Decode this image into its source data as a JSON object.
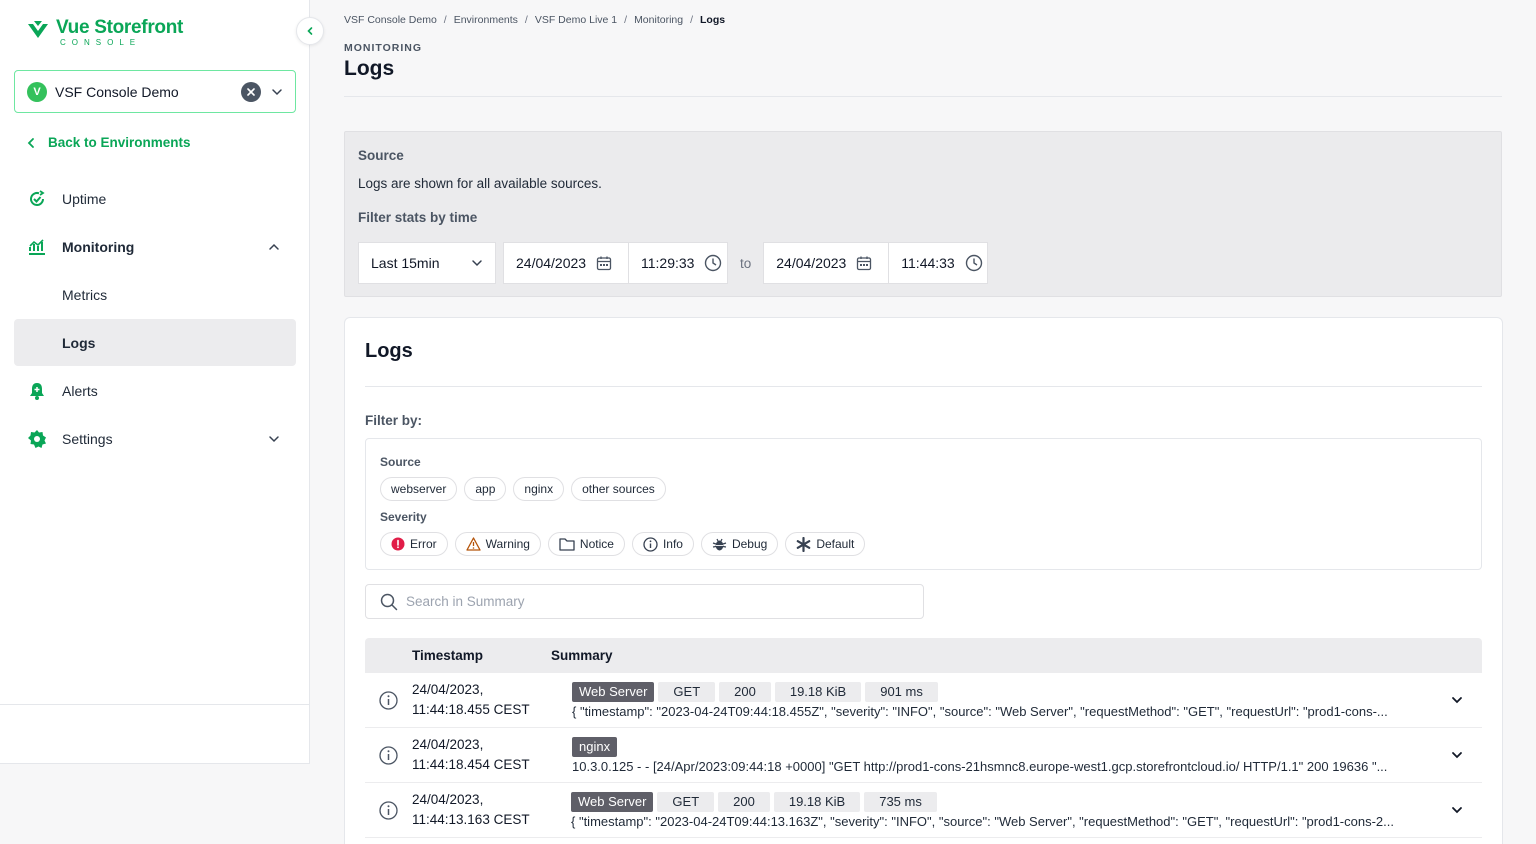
{
  "sidebar": {
    "logo_title": "Vue Storefront",
    "logo_subtitle": "CONSOLE",
    "organization": {
      "initial": "V",
      "name": "VSF Console Demo"
    },
    "back_label": "Back to Environments",
    "items": [
      {
        "label": "Uptime"
      },
      {
        "label": "Monitoring"
      },
      {
        "label": "Metrics"
      },
      {
        "label": "Logs"
      },
      {
        "label": "Alerts"
      },
      {
        "label": "Settings"
      }
    ]
  },
  "breadcrumb": [
    "VSF Console Demo",
    "Environments",
    "VSF Demo Live 1",
    "Monitoring",
    "Logs"
  ],
  "page": {
    "kicker": "MONITORING",
    "title": "Logs"
  },
  "source_panel": {
    "heading": "Source",
    "text": "Logs are shown for all available sources.",
    "filter_heading": "Filter stats by time",
    "range": "Last 15min",
    "from_date": "24/04/2023",
    "from_time": "11:29:33",
    "to_label": "to",
    "to_date": "24/04/2023",
    "to_time": "11:44:33"
  },
  "logs": {
    "title": "Logs",
    "filter_by": "Filter by:",
    "source_label": "Source",
    "sources": [
      "webserver",
      "app",
      "nginx",
      "other sources"
    ],
    "severity_label": "Severity",
    "severities": [
      "Error",
      "Warning",
      "Notice",
      "Info",
      "Debug",
      "Default"
    ],
    "search_placeholder": "Search in Summary",
    "columns": {
      "timestamp": "Timestamp",
      "summary": "Summary"
    },
    "rows": [
      {
        "date": "24/04/2023,",
        "time": "11:44:18.455 CEST",
        "tags": [
          "Web Server",
          "GET",
          "200",
          "19.18 KiB",
          "901 ms"
        ],
        "summary": "{ \"timestamp\": \"2023-04-24T09:44:18.455Z\", \"severity\": \"INFO\", \"source\": \"Web Server\", \"requestMethod\": \"GET\", \"requestUrl\": \"prod1-cons-..."
      },
      {
        "date": "24/04/2023,",
        "time": "11:44:18.454 CEST",
        "tags": [
          "nginx"
        ],
        "summary": "10.3.0.125 - - [24/Apr/2023:09:44:18 +0000] \"GET http://prod1-cons-21hsmnc8.europe-west1.gcp.storefrontcloud.io/ HTTP/1.1\" 200 19636 \"..."
      },
      {
        "date": "24/04/2023,",
        "time": "11:44:13.163 CEST",
        "tags": [
          "Web Server",
          "GET",
          "200",
          "19.18 KiB",
          "735 ms"
        ],
        "summary": "{ \"timestamp\": \"2023-04-24T09:44:13.163Z\", \"severity\": \"INFO\", \"source\": \"Web Server\", \"requestMethod\": \"GET\", \"requestUrl\": \"prod1-cons-2..."
      }
    ]
  },
  "colors": {
    "brand": "#0aa657",
    "avatar": "#34c15c",
    "error": "#e11d48"
  }
}
